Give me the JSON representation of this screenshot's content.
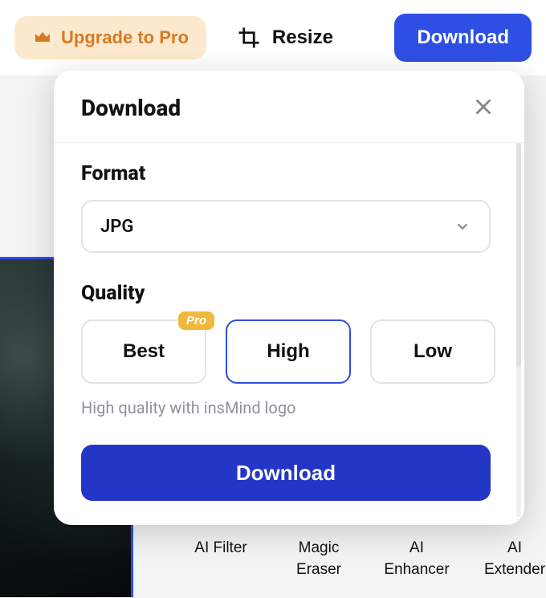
{
  "header": {
    "upgrade_label": "Upgrade to Pro",
    "resize_label": "Resize",
    "download_label": "Download"
  },
  "modal": {
    "title": "Download",
    "format_label": "Format",
    "format_value": "JPG",
    "quality_label": "Quality",
    "quality_options": {
      "best": "Best",
      "high": "High",
      "low": "Low"
    },
    "quality_selected": "High",
    "pro_badge": "Pro",
    "quality_note": "High quality with insMind logo",
    "download_button": "Download"
  },
  "tools": {
    "ai_filter": "AI Filter",
    "magic_eraser": "Magic Eraser",
    "ai_enhancer": "AI Enhancer",
    "ai_extender": "AI Extender"
  }
}
